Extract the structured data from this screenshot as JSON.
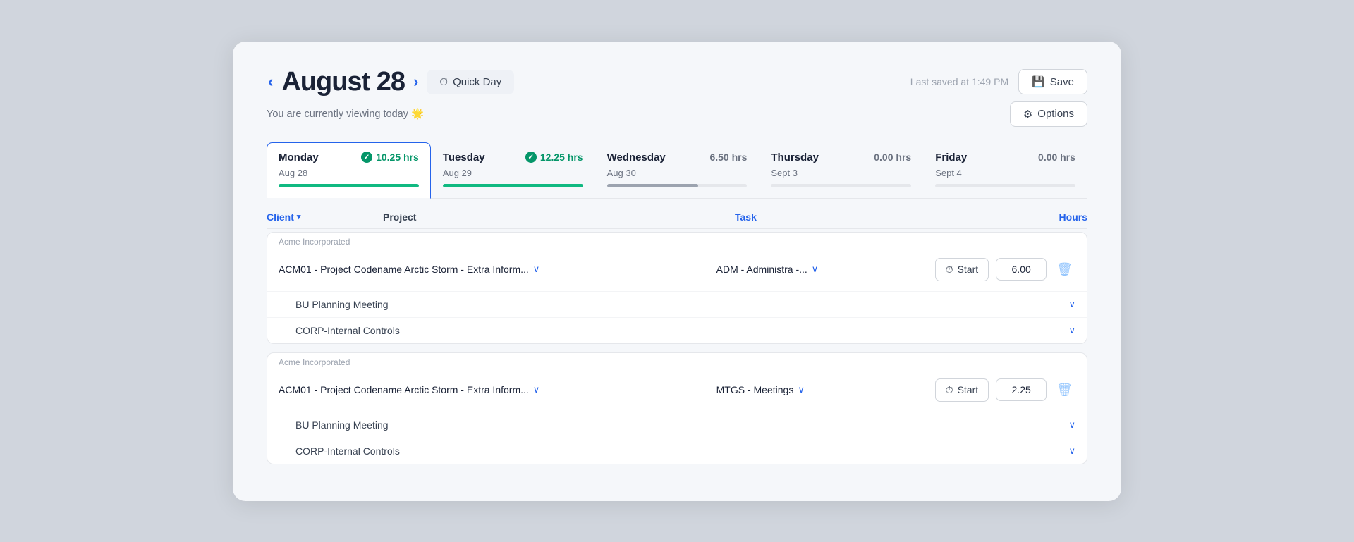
{
  "header": {
    "prev_arrow": "‹",
    "next_arrow": "›",
    "date": "August 28",
    "quick_day_label": "Quick Day",
    "last_saved": "Last saved at 1:49 PM",
    "save_label": "Save",
    "options_label": "Options"
  },
  "subtitle": {
    "text": "You are currently viewing today",
    "emoji": "🌟"
  },
  "days": [
    {
      "name": "Monday",
      "date": "Aug 28",
      "hours": "10.25 hrs",
      "progress": 100,
      "style": "green",
      "active": true
    },
    {
      "name": "Tuesday",
      "date": "Aug 29",
      "hours": "12.25 hrs",
      "progress": 100,
      "style": "green",
      "active": false
    },
    {
      "name": "Wednesday",
      "date": "Aug 30",
      "hours": "6.50 hrs",
      "progress": 65,
      "style": "gray",
      "active": false
    },
    {
      "name": "Thursday",
      "date": "Sept 3",
      "hours": "0.00 hrs",
      "progress": 0,
      "style": "light",
      "active": false
    },
    {
      "name": "Friday",
      "date": "Sept 4",
      "hours": "0.00 hrs",
      "progress": 0,
      "style": "light",
      "active": false
    }
  ],
  "table_headers": {
    "client": "Client",
    "project": "Project",
    "task": "Task",
    "hours": "Hours"
  },
  "entries": [
    {
      "client": "Acme Incorporated",
      "project": "ACM01 - Project Codename Arctic Storm - Extra Inform...",
      "task": "ADM - Administra -...",
      "hours": "6.00",
      "sub_entries": [
        {
          "label": "BU Planning Meeting"
        },
        {
          "label": "CORP-Internal Controls"
        }
      ]
    },
    {
      "client": "Acme Incorporated",
      "project": "ACM01 - Project Codename Arctic Storm - Extra Inform...",
      "task": "MTGS - Meetings",
      "hours": "2.25",
      "sub_entries": [
        {
          "label": "BU Planning Meeting"
        },
        {
          "label": "CORP-Internal Controls"
        }
      ]
    }
  ],
  "icons": {
    "quick_day": "⏱",
    "save": "💾",
    "options": "⚙",
    "check": "✓",
    "timer": "⏱",
    "trash": "🗑",
    "chevron_down": "∨"
  },
  "colors": {
    "accent": "#2563eb",
    "green": "#059669",
    "progress_green": "#10b981",
    "progress_gray": "#9ca3af",
    "progress_light": "#e5e7eb"
  }
}
